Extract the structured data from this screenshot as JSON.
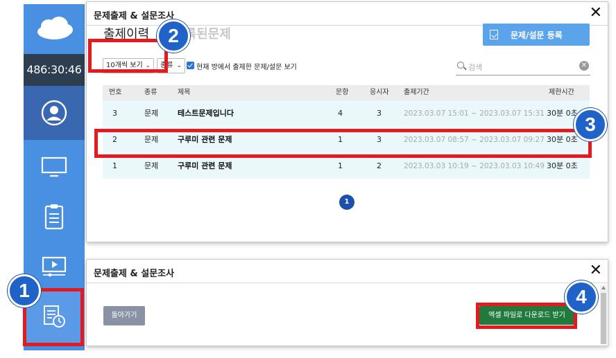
{
  "sidebar": {
    "timer": "486:30:46",
    "items": [
      {
        "icon": "cloud-logo-icon"
      },
      {
        "icon": "user-profile-icon"
      },
      {
        "icon": "monitor-icon"
      },
      {
        "icon": "clipboard-icon"
      },
      {
        "icon": "video-player-icon"
      },
      {
        "icon": "quiz-history-icon"
      }
    ]
  },
  "markers": [
    "1",
    "2",
    "3",
    "4"
  ],
  "main_window": {
    "title": "문제출제 & 설문조사",
    "close": "✕",
    "tabs": [
      {
        "label": "출제이력",
        "active": true
      },
      {
        "label": "등록된문제",
        "active": false
      }
    ],
    "register_button": "문제/설문 등록",
    "filters": {
      "page_size": "10개씩 보기",
      "type": "종류",
      "checkbox_label": "현재 방에서 출제한 문제/설문 보기",
      "checkbox_checked": true,
      "search_placeholder": "검색"
    },
    "table": {
      "columns": [
        "번호",
        "종류",
        "제목",
        "문항",
        "응시자",
        "출제기간",
        "제한시간"
      ],
      "rows": [
        {
          "no": "3",
          "type": "문제",
          "title": "테스트문제입니다",
          "items": "4",
          "takers": "3",
          "period": "2023.03.07 15:01 ~ 2023.03.07 15:31",
          "limit": "30분 0초"
        },
        {
          "no": "2",
          "type": "문제",
          "title": "구루미 관련 문제",
          "items": "1",
          "takers": "3",
          "period": "2023.03.07 08:57 ~ 2023.03.07 09:27",
          "limit": "30분 0초"
        },
        {
          "no": "1",
          "type": "문제",
          "title": "구루미 관련 문제",
          "items": "1",
          "takers": "2",
          "period": "2023.03.03 10:19 ~ 2023.03.03 10:49",
          "limit": "30분 0초"
        }
      ]
    },
    "page": "1"
  },
  "detail_window": {
    "title": "문제출제 & 설문조사",
    "close": "✕",
    "back_button": "돌아가기",
    "download_button": "엑셀 파일로 다운로드 받기"
  },
  "colors": {
    "sidebar": "#4a90e2",
    "timer_bg": "#2c3e50",
    "marker_red": "#e6191e",
    "badge_blue": "#1f63c8",
    "register_button": "#5ba4ec",
    "download_button": "#1f7a3c",
    "row_highlight": "#eaf7fb"
  }
}
